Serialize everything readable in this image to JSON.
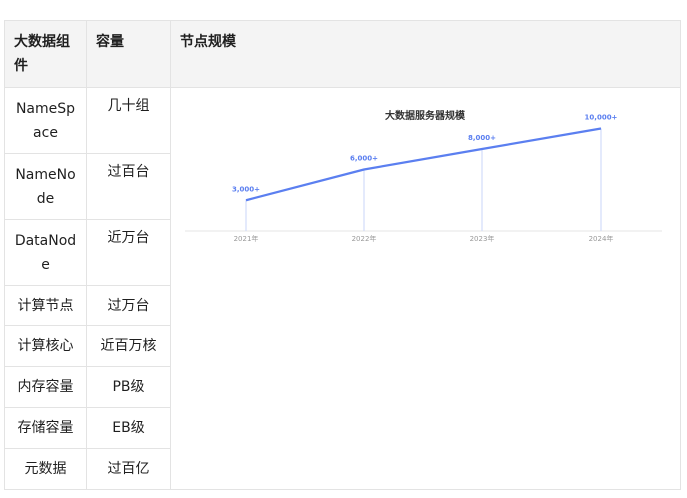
{
  "table": {
    "headers": [
      "大数据组件",
      "容量",
      "节点规模"
    ],
    "rows": [
      {
        "component": "NameSpace",
        "capacity": "几十组"
      },
      {
        "component": "NameNode",
        "capacity": "过百台"
      },
      {
        "component": "DataNode",
        "capacity": "近万台"
      },
      {
        "component": "计算节点",
        "capacity": "过万台"
      },
      {
        "component": "计算核心",
        "capacity": "近百万核"
      },
      {
        "component": "内存容量",
        "capacity": "PB级"
      },
      {
        "component": "存储容量",
        "capacity": "EB级"
      },
      {
        "component": "元数据",
        "capacity": "过百亿"
      }
    ]
  },
  "chart_data": {
    "type": "line",
    "title": "大数据服务器规模",
    "categories": [
      "2021年",
      "2022年",
      "2023年",
      "2024年"
    ],
    "series": [
      {
        "values": [
          3000,
          6000,
          8000,
          10000
        ],
        "labels": [
          "3,000+",
          "6,000+",
          "8,000+",
          "10,000+"
        ]
      }
    ],
    "ylim": [
      0,
      12000
    ],
    "grid": false,
    "color": "#5b7ff0"
  }
}
